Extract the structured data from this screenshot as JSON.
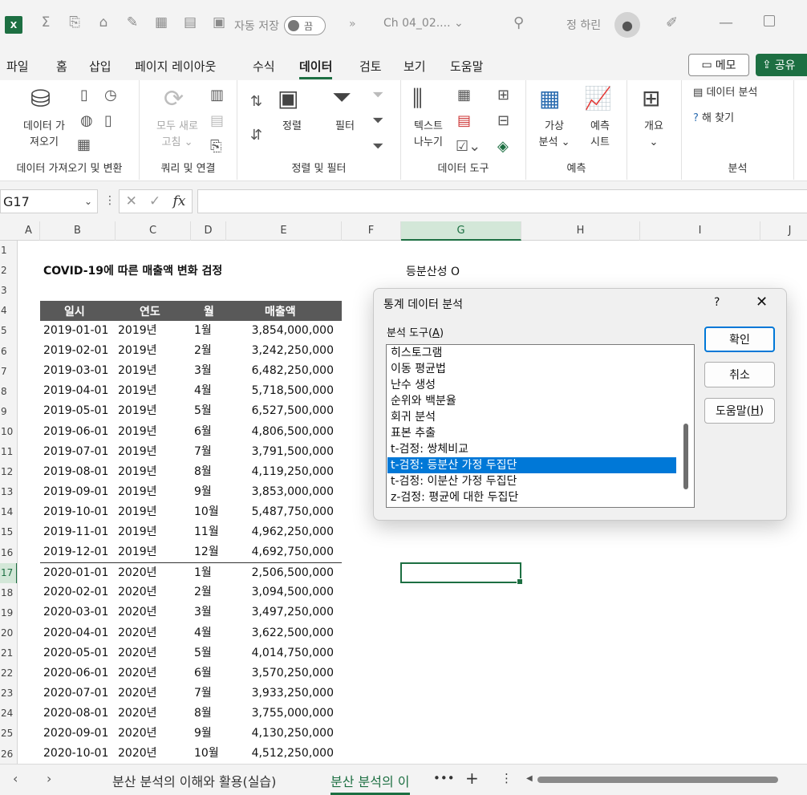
{
  "titlebar": {
    "logo": "X",
    "autosave_label": "자동 저장",
    "autosave_state": "끔",
    "more": "»",
    "filename": "Ch 04_02....",
    "user_name": "정 하린"
  },
  "menu": {
    "tabs": [
      "파일",
      "홈",
      "삽입",
      "페이지 레이아웃",
      "수식",
      "데이터",
      "검토",
      "보기",
      "도움말"
    ],
    "active": "데이터",
    "memo_label": "메모",
    "share_label": "공유"
  },
  "ribbon": {
    "get_data_1": "데이터 가",
    "get_data_2": "져오기",
    "refresh_all_1": "모두 새로",
    "refresh_all_2": "고침",
    "sort": "정렬",
    "filter": "필터",
    "text_to_cols_1": "텍스트",
    "text_to_cols_2": "나누기",
    "what_if_1": "가상",
    "what_if_2": "분석",
    "forecast_1": "예측",
    "forecast_2": "시트",
    "outline": "개요",
    "data_analysis": "데이터 분석",
    "solver": "해 찾기",
    "groups": {
      "get_transform": "데이터 가져오기 및 변환",
      "queries": "쿼리 및 연결",
      "sort_filter": "정렬 및 필터",
      "data_tools": "데이터 도구",
      "forecast": "예측",
      "analysis": "분석"
    }
  },
  "formula_bar": {
    "name_box": "G17",
    "fx": "fx",
    "value": ""
  },
  "grid": {
    "columns": [
      "A",
      "B",
      "C",
      "D",
      "E",
      "F",
      "G",
      "H",
      "I",
      "J"
    ],
    "selected_column": "G",
    "selected_row": "17",
    "rows": [
      "1",
      "2",
      "3",
      "4",
      "5",
      "6",
      "7",
      "8",
      "9",
      "10",
      "11",
      "12",
      "13",
      "14",
      "15",
      "16",
      "17",
      "18",
      "19",
      "20",
      "21",
      "22",
      "23",
      "24",
      "25",
      "26"
    ],
    "title": "COVID-19에 따른 매출액 변화 검정",
    "equal_variance_note": "등분산성 O",
    "headers": [
      "일시",
      "연도",
      "월",
      "매출액"
    ],
    "data": [
      [
        "2019-01-01",
        "2019년",
        "1월",
        "3,854,000,000"
      ],
      [
        "2019-02-01",
        "2019년",
        "2월",
        "3,242,250,000"
      ],
      [
        "2019-03-01",
        "2019년",
        "3월",
        "6,482,250,000"
      ],
      [
        "2019-04-01",
        "2019년",
        "4월",
        "5,718,500,000"
      ],
      [
        "2019-05-01",
        "2019년",
        "5월",
        "6,527,500,000"
      ],
      [
        "2019-06-01",
        "2019년",
        "6월",
        "4,806,500,000"
      ],
      [
        "2019-07-01",
        "2019년",
        "7월",
        "3,791,500,000"
      ],
      [
        "2019-08-01",
        "2019년",
        "8월",
        "4,119,250,000"
      ],
      [
        "2019-09-01",
        "2019년",
        "9월",
        "3,853,000,000"
      ],
      [
        "2019-10-01",
        "2019년",
        "10월",
        "5,487,750,000"
      ],
      [
        "2019-11-01",
        "2019년",
        "11월",
        "4,962,250,000"
      ],
      [
        "2019-12-01",
        "2019년",
        "12월",
        "4,692,750,000"
      ],
      [
        "2020-01-01",
        "2020년",
        "1월",
        "2,506,500,000"
      ],
      [
        "2020-02-01",
        "2020년",
        "2월",
        "3,094,500,000"
      ],
      [
        "2020-03-01",
        "2020년",
        "3월",
        "3,497,250,000"
      ],
      [
        "2020-04-01",
        "2020년",
        "4월",
        "3,622,500,000"
      ],
      [
        "2020-05-01",
        "2020년",
        "5월",
        "4,014,750,000"
      ],
      [
        "2020-06-01",
        "2020년",
        "6월",
        "3,570,250,000"
      ],
      [
        "2020-07-01",
        "2020년",
        "7월",
        "3,933,250,000"
      ],
      [
        "2020-08-01",
        "2020년",
        "8월",
        "3,755,000,000"
      ],
      [
        "2020-09-01",
        "2020년",
        "9월",
        "4,130,250,000"
      ],
      [
        "2020-10-01",
        "2020년",
        "10월",
        "4,512,250,000"
      ]
    ]
  },
  "dialog": {
    "title": "통계 데이터 분석",
    "help": "?",
    "close": "✕",
    "tools_label": "분석 도구(",
    "tools_label_key": "A",
    "tools_label_end": ")",
    "items": [
      "히스토그램",
      "이동 평균법",
      "난수 생성",
      "순위와 백분율",
      "회귀 분석",
      "표본 추출",
      "t-검정: 쌍체비교",
      "t-검정: 등분산 가정 두집단",
      "t-검정: 이분산 가정 두집단",
      "z-검정: 평균에 대한 두집단"
    ],
    "selected_index": 7,
    "ok": "확인",
    "cancel": "취소",
    "help_btn": "도움말(",
    "help_btn_key": "H",
    "help_btn_end": ")"
  },
  "sheets": {
    "tabs": [
      "분산 분석의 이해와 활용(실습)",
      "분산 분석의 이"
    ],
    "active_index": 1,
    "more": "•••",
    "add": "+",
    "options": "⋮"
  }
}
